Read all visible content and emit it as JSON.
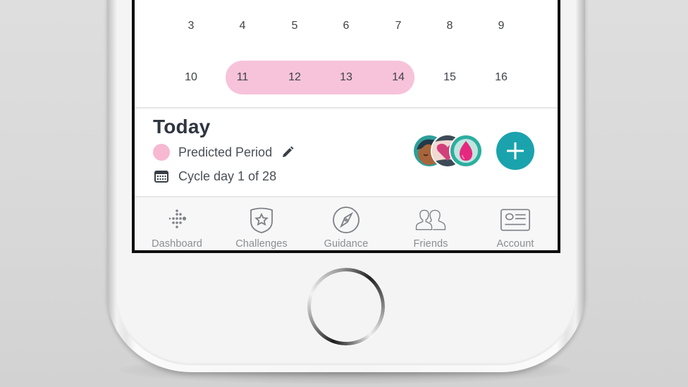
{
  "calendar": {
    "rows": [
      [
        "3",
        "4",
        "5",
        "6",
        "7",
        "8",
        "9"
      ],
      [
        "10",
        "11",
        "12",
        "13",
        "14",
        "15",
        "16"
      ]
    ],
    "highlighted_days": [
      "11",
      "12",
      "13",
      "14"
    ],
    "highlight_color": "#f7c3da"
  },
  "today": {
    "title": "Today",
    "status_label": "Predicted Period",
    "status_icon": "pink-dot",
    "status_color": "#f7b9d2",
    "edit_icon": "pencil-icon",
    "cycle_icon": "calendar-icon",
    "cycle_text": "Cycle day 1 of 28",
    "avatars": [
      {
        "name": "person-avatar"
      },
      {
        "name": "heart-avatar"
      },
      {
        "name": "blood-drop-avatar"
      }
    ],
    "add_button": {
      "icon": "plus-icon",
      "color": "#1aa3ad"
    }
  },
  "tabbar": {
    "tabs": [
      {
        "label": "Dashboard",
        "icon": "fitbit-dots-icon"
      },
      {
        "label": "Challenges",
        "icon": "star-badge-icon"
      },
      {
        "label": "Guidance",
        "icon": "compass-icon"
      },
      {
        "label": "Friends",
        "icon": "friends-icon"
      },
      {
        "label": "Account",
        "icon": "id-card-icon"
      }
    ]
  },
  "device": {
    "home_button": "home-button"
  }
}
